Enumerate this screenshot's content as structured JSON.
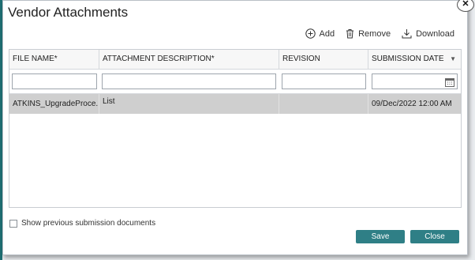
{
  "dialog": {
    "title": "Vendor Attachments"
  },
  "toolbar": {
    "add": "Add",
    "remove": "Remove",
    "download": "Download"
  },
  "grid": {
    "columns": [
      "FILE NAME*",
      "ATTACHMENT DESCRIPTION*",
      "REVISION",
      "SUBMISSION DATE"
    ],
    "rows": [
      {
        "file_name": "ATKINS_UpgradeProce...",
        "description": "List",
        "revision": "",
        "submission_date": "09/Dec/2022 12:00 AM"
      }
    ]
  },
  "footer": {
    "checkbox_label": "Show previous submission documents",
    "save": "Save",
    "close": "Close"
  },
  "colors": {
    "accent": "#2f7f86",
    "selected_row": "#cfcfcf"
  }
}
